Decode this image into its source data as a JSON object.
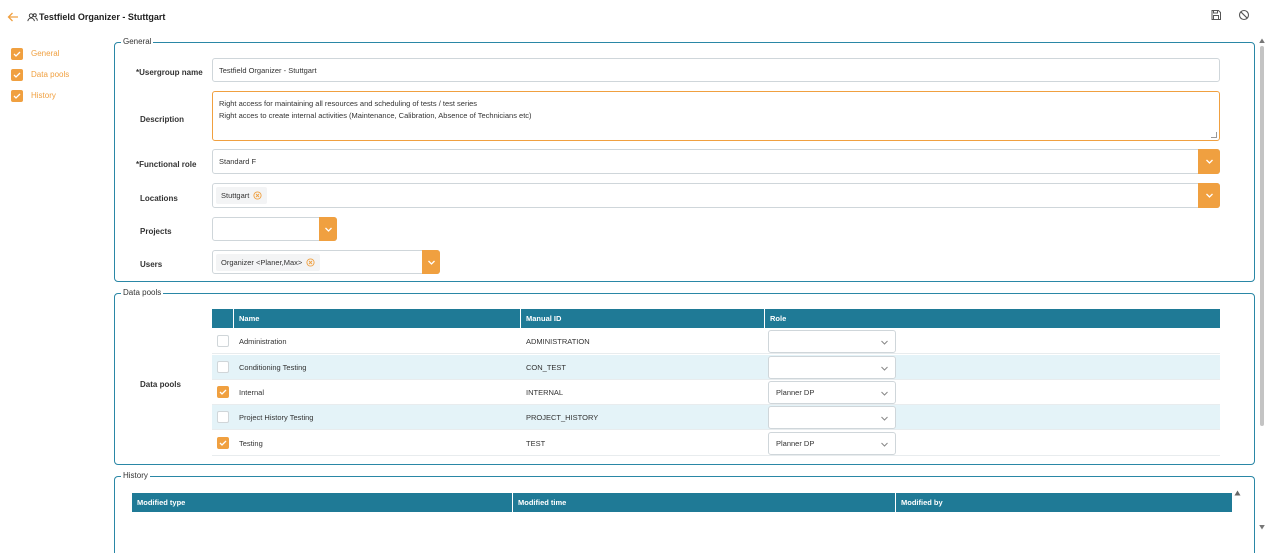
{
  "header": {
    "title": "Testfield Organizer - Stuttgart"
  },
  "nav": {
    "items": [
      {
        "label": "General"
      },
      {
        "label": "Data pools"
      },
      {
        "label": "History"
      }
    ]
  },
  "general": {
    "legend": "General",
    "usergroup_label": "*Usergroup name",
    "usergroup_value": "Testfield Organizer - Stuttgart",
    "description_label": "Description",
    "description_line1": "Right access for maintaining all resources and scheduling of tests / test series",
    "description_line2": "Right acces to create internal activities (Maintenance, Calibration, Absence of Technicians etc)",
    "functional_role_label": "*Functional role",
    "functional_role_value": "Standard F",
    "locations_label": "Locations",
    "location_chip": "Stuttgart",
    "projects_label": "Projects",
    "users_label": "Users",
    "user_chip": "Organizer <Planer,Max>"
  },
  "datapools": {
    "legend": "Data pools",
    "label": "Data pools",
    "columns": [
      "Name",
      "Manual ID",
      "Role"
    ],
    "rows": [
      {
        "name": "Administration",
        "manual_id": "ADMINISTRATION",
        "role": "",
        "checked": false
      },
      {
        "name": "Conditioning Testing",
        "manual_id": "CON_TEST",
        "role": "",
        "checked": false
      },
      {
        "name": "Internal",
        "manual_id": "INTERNAL",
        "role": "Planner DP",
        "checked": true
      },
      {
        "name": "Project History Testing",
        "manual_id": "PROJECT_HISTORY",
        "role": "",
        "checked": false
      },
      {
        "name": "Testing",
        "manual_id": "TEST",
        "role": "Planner DP",
        "checked": true
      }
    ]
  },
  "history": {
    "legend": "History",
    "columns": [
      "Modified type",
      "Modified time",
      "Modified by"
    ]
  },
  "colors": {
    "accent": "#f0a040",
    "table_header": "#1f7a96",
    "section_border": "#2a87a6",
    "row_alt": "#e4f3f8"
  },
  "icons": {
    "back": "arrow-left-icon",
    "group": "user-group-icon",
    "save": "save-icon",
    "cancel": "cancel-icon",
    "dropdown": "chevron-down-icon",
    "remove": "remove-circle-icon"
  }
}
